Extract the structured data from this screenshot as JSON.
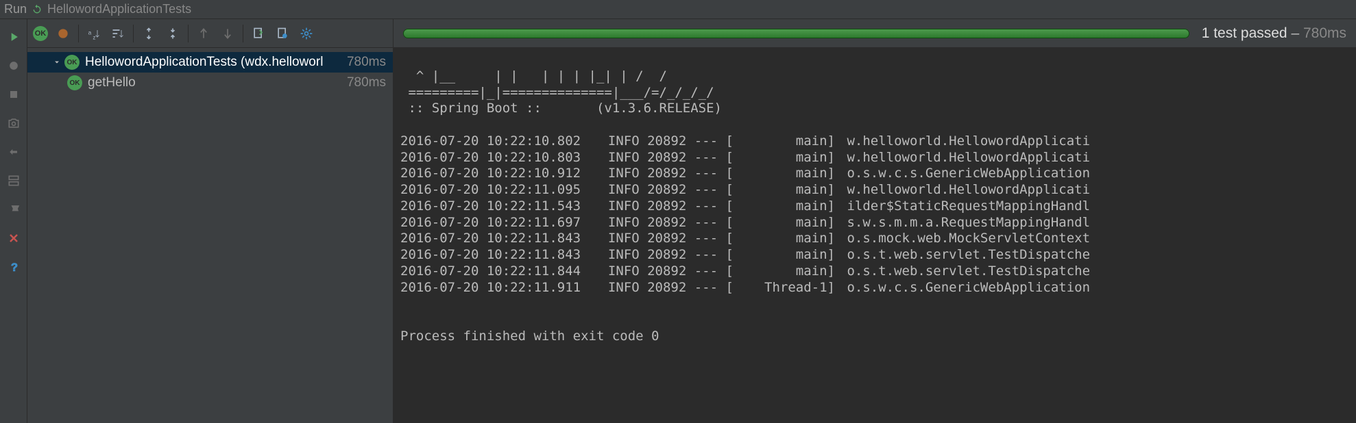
{
  "header": {
    "run_label": "Run",
    "title": "HellowordApplicationTests"
  },
  "gutter": {
    "run": "run-icon",
    "debug": "debug-icon",
    "stop": "stop-icon",
    "camera": "camera-icon",
    "exit": "exit-icon",
    "layout": "layout-icon",
    "pin": "pin-icon",
    "close": "close-icon",
    "help": "help-icon"
  },
  "toolbar": {
    "show_passed": "OK",
    "show_ignored": "show-ignored-icon",
    "sort": "sort-icon",
    "sort_duration": "sort-duration-icon",
    "expand": "expand-all-icon",
    "collapse": "collapse-all-icon",
    "prev": "prev-icon",
    "next": "next-icon",
    "export": "export-icon",
    "import": "import-icon",
    "settings": "settings-icon"
  },
  "tree": {
    "root": {
      "label": "HellowordApplicationTests (wdx.helloworl",
      "time": "780ms",
      "child": {
        "label": "getHello",
        "time": "780ms"
      }
    }
  },
  "status": {
    "passed_text": "1 test passed",
    "dash": " – ",
    "time": "780ms"
  },
  "console": {
    "ascii1": "  ^ |__     | |   | | | |_| | /  /",
    "ascii2": " =========|_|==============|___/=/_/_/_/",
    "banner": " :: Spring Boot ::       (v1.3.6.RELEASE)",
    "logs": [
      {
        "ts": "2016-07-20 10:22:10.802",
        "lvl": "INFO 20892 --- [",
        "thread": "main]",
        "msg": "w.helloworld.HellowordApplicati"
      },
      {
        "ts": "2016-07-20 10:22:10.803",
        "lvl": "INFO 20892 --- [",
        "thread": "main]",
        "msg": "w.helloworld.HellowordApplicati"
      },
      {
        "ts": "2016-07-20 10:22:10.912",
        "lvl": "INFO 20892 --- [",
        "thread": "main]",
        "msg": "o.s.w.c.s.GenericWebApplication"
      },
      {
        "ts": "2016-07-20 10:22:11.095",
        "lvl": "INFO 20892 --- [",
        "thread": "main]",
        "msg": "w.helloworld.HellowordApplicati"
      },
      {
        "ts": "2016-07-20 10:22:11.543",
        "lvl": "INFO 20892 --- [",
        "thread": "main]",
        "msg": "ilder$StaticRequestMappingHandl"
      },
      {
        "ts": "2016-07-20 10:22:11.697",
        "lvl": "INFO 20892 --- [",
        "thread": "main]",
        "msg": "s.w.s.m.m.a.RequestMappingHandl"
      },
      {
        "ts": "2016-07-20 10:22:11.843",
        "lvl": "INFO 20892 --- [",
        "thread": "main]",
        "msg": "o.s.mock.web.MockServletContext"
      },
      {
        "ts": "2016-07-20 10:22:11.843",
        "lvl": "INFO 20892 --- [",
        "thread": "main]",
        "msg": "o.s.t.web.servlet.TestDispatche"
      },
      {
        "ts": "2016-07-20 10:22:11.844",
        "lvl": "INFO 20892 --- [",
        "thread": "main]",
        "msg": "o.s.t.web.servlet.TestDispatche"
      },
      {
        "ts": "2016-07-20 10:22:11.911",
        "lvl": "INFO 20892 --- [",
        "thread": "Thread-1]",
        "msg": "o.s.w.c.s.GenericWebApplication"
      }
    ],
    "exit": "Process finished with exit code 0"
  }
}
